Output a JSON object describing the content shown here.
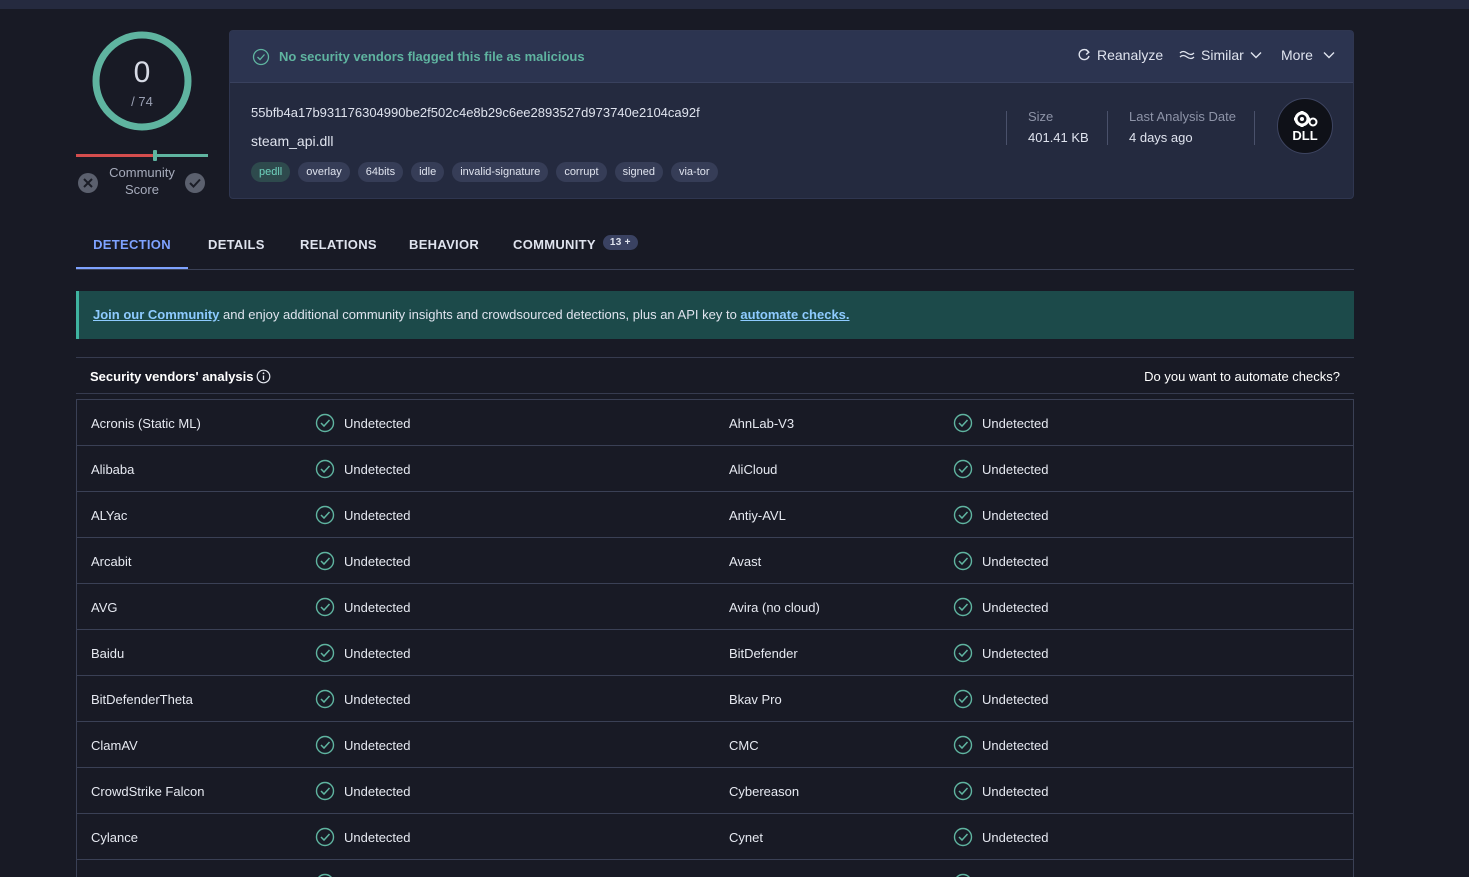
{
  "score": {
    "detections": "0",
    "total": "/ 74",
    "community_label_1": "Community",
    "community_label_2": "Score"
  },
  "colors": {
    "accent": "#5fb4a0",
    "tab_active": "#7ea2ff",
    "link": "#8ecbff",
    "banner_bg": "#1c4a4a"
  },
  "file": {
    "status": "No security vendors flagged this file as malicious",
    "hash": "55bfb4a17b931176304990be2f502c4e8b29c6ee2893527d973740e2104ca92f",
    "name": "steam_api.dll",
    "tags": [
      "pedll",
      "overlay",
      "64bits",
      "idle",
      "invalid-signature",
      "corrupt",
      "signed",
      "via-tor"
    ],
    "size_label": "Size",
    "size_value": "401.41 KB",
    "date_label": "Last Analysis Date",
    "date_value": "4 days ago",
    "type_icon_text": "DLL"
  },
  "actions": {
    "reanalyze": "Reanalyze",
    "similar": "Similar",
    "more": "More"
  },
  "tabs": [
    {
      "label": "DETECTION",
      "active": true
    },
    {
      "label": "DETAILS"
    },
    {
      "label": "RELATIONS"
    },
    {
      "label": "BEHAVIOR"
    },
    {
      "label": "COMMUNITY",
      "badge": "13 +"
    }
  ],
  "banner": {
    "link1": "Join our Community",
    "text": " and enjoy additional community insights and crowdsourced detections, plus an API key to ",
    "link2": "automate checks."
  },
  "vendors": {
    "title": "Security vendors' analysis",
    "automate_prompt": "Do you want to automate checks?",
    "rows": [
      [
        {
          "name": "Acronis (Static ML)",
          "result": "Undetected"
        },
        {
          "name": "AhnLab-V3",
          "result": "Undetected"
        }
      ],
      [
        {
          "name": "Alibaba",
          "result": "Undetected"
        },
        {
          "name": "AliCloud",
          "result": "Undetected"
        }
      ],
      [
        {
          "name": "ALYac",
          "result": "Undetected"
        },
        {
          "name": "Antiy-AVL",
          "result": "Undetected"
        }
      ],
      [
        {
          "name": "Arcabit",
          "result": "Undetected"
        },
        {
          "name": "Avast",
          "result": "Undetected"
        }
      ],
      [
        {
          "name": "AVG",
          "result": "Undetected"
        },
        {
          "name": "Avira (no cloud)",
          "result": "Undetected"
        }
      ],
      [
        {
          "name": "Baidu",
          "result": "Undetected"
        },
        {
          "name": "BitDefender",
          "result": "Undetected"
        }
      ],
      [
        {
          "name": "BitDefenderTheta",
          "result": "Undetected"
        },
        {
          "name": "Bkav Pro",
          "result": "Undetected"
        }
      ],
      [
        {
          "name": "ClamAV",
          "result": "Undetected"
        },
        {
          "name": "CMC",
          "result": "Undetected"
        }
      ],
      [
        {
          "name": "CrowdStrike Falcon",
          "result": "Undetected"
        },
        {
          "name": "Cybereason",
          "result": "Undetected"
        }
      ],
      [
        {
          "name": "Cylance",
          "result": "Undetected"
        },
        {
          "name": "Cynet",
          "result": "Undetected"
        }
      ],
      [
        {
          "name": "",
          "result": ""
        },
        {
          "name": "",
          "result": ""
        }
      ]
    ]
  }
}
